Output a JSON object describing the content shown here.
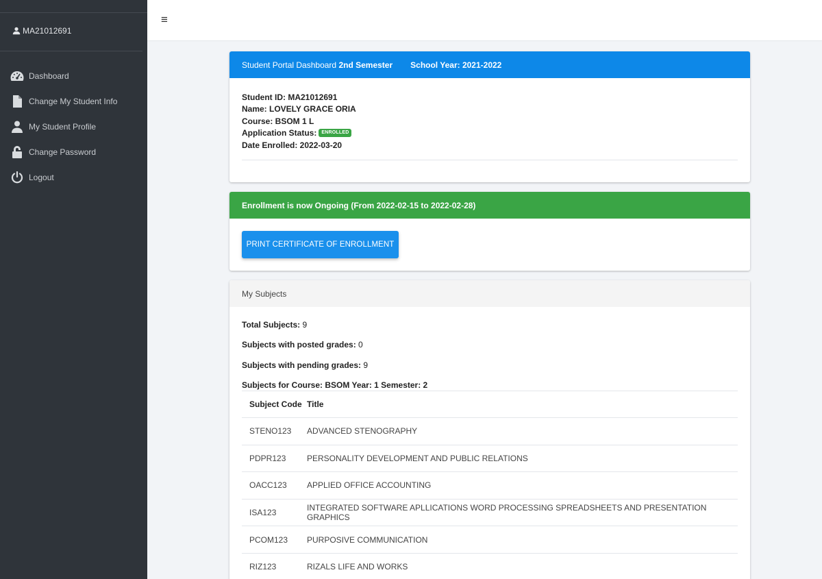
{
  "sidebar": {
    "username": "MA21012691",
    "items": [
      {
        "label": "Dashboard",
        "icon": "dashboard-icon"
      },
      {
        "label": "Change My Student Info",
        "icon": "file-icon"
      },
      {
        "label": "My Student Profile",
        "icon": "user-icon"
      },
      {
        "label": "Change Password",
        "icon": "lock-icon"
      },
      {
        "label": "Logout",
        "icon": "power-icon"
      }
    ]
  },
  "header": {
    "menu_icon": "hamburger-icon"
  },
  "dashboard_card": {
    "title_prefix": "Student Portal Dashboard",
    "semester": "2nd Semester",
    "school_year": "School Year: 2021-2022",
    "student_id": "Student ID: MA21012691",
    "name": "Name: LOVELY GRACE ORIA",
    "course": "Course: BSOM 1 L",
    "status_label": "Application Status:",
    "status_badge": "ENROLLED",
    "date_enrolled": "Date Enrolled: 2022-03-20"
  },
  "enrollment_card": {
    "title": "Enrollment is now Ongoing (From 2022-02-15 to 2022-02-28)",
    "button_label": "PRINT CERTIFICATE OF ENROLLMENT"
  },
  "subjects_card": {
    "title": "My Subjects",
    "total_label": "Total Subjects:",
    "total_value": "9",
    "posted_label": "Subjects with posted grades:",
    "posted_value": "0",
    "pending_label": "Subjects with pending grades:",
    "pending_value": "9",
    "course_line": "Subjects for Course: BSOM Year: 1 Semester: 2",
    "columns": [
      "Subject Code",
      "Title"
    ],
    "rows": [
      {
        "code": "STENO123",
        "title": "ADVANCED STENOGRAPHY"
      },
      {
        "code": "PDPR123",
        "title": "PERSONALITY DEVELOPMENT AND PUBLIC RELATIONS"
      },
      {
        "code": "OACC123",
        "title": "APPLIED OFFICE ACCOUNTING"
      },
      {
        "code": "ISA123",
        "title": "INTEGRATED SOFTWARE APLLICATIONS WORD PROCESSING SPREADSHEETS AND PRESENTATION GRAPHICS"
      },
      {
        "code": "PCOM123",
        "title": "PURPOSIVE COMMUNICATION"
      },
      {
        "code": "RIZ123",
        "title": "RIZALS LIFE AND WORKS"
      }
    ]
  },
  "colors": {
    "sidebar_bg": "#2f343a",
    "primary": "#0d88e8",
    "success": "#3aa545",
    "button": "#1a90ec"
  }
}
